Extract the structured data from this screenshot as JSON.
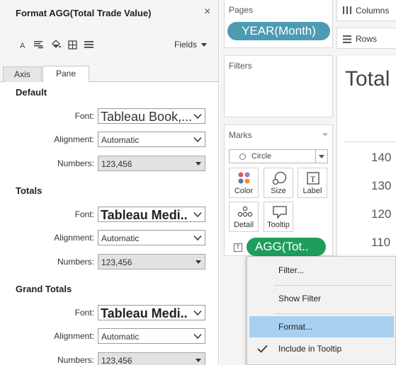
{
  "format_pane": {
    "title": "Format AGG(Total Trade Value)",
    "close_label": "×",
    "toolbar_icons": [
      "font-icon",
      "alignment-icon",
      "shading-icon",
      "borders-icon",
      "lines-icon"
    ],
    "fields_label": "Fields",
    "tabs": [
      {
        "label": "Axis",
        "active": false
      },
      {
        "label": "Pane",
        "active": true
      }
    ],
    "labels": {
      "font": "Font:",
      "alignment": "Alignment:",
      "numbers": "Numbers:"
    },
    "sections": [
      {
        "title": "Default",
        "font": "Tableau Book,...",
        "alignment": "Automatic",
        "numbers": "123,456"
      },
      {
        "title": "Totals",
        "font": "Tableau Medi..",
        "alignment": "Automatic",
        "numbers": "123,456"
      },
      {
        "title": "Grand Totals",
        "font": "Tableau Medi..",
        "alignment": "Automatic",
        "numbers": "123,456"
      }
    ]
  },
  "pages": {
    "title": "Pages",
    "pill": "YEAR(Month)",
    "pill_color": "#4d9bb3"
  },
  "filters": {
    "title": "Filters"
  },
  "marks": {
    "title": "Marks",
    "mark_type": "Circle",
    "buttons": [
      {
        "label": "Color",
        "icon": "color-icon"
      },
      {
        "label": "Size",
        "icon": "size-icon"
      },
      {
        "label": "Label",
        "icon": "label-icon"
      },
      {
        "label": "Detail",
        "icon": "detail-icon"
      },
      {
        "label": "Tooltip",
        "icon": "tooltip-icon"
      }
    ],
    "field_pill": "AGG(Tot..",
    "field_pill_color": "#1d9e5d"
  },
  "shelves": {
    "columns": "Columns",
    "rows": "Rows"
  },
  "view": {
    "title": "Total",
    "axis_ticks": [
      "140",
      "130",
      "120",
      "110"
    ]
  },
  "context_menu": {
    "items": [
      {
        "label": "Filter...",
        "highlighted": false,
        "checked": false
      },
      {
        "label": "Show Filter",
        "highlighted": false,
        "checked": false
      },
      {
        "label": "Format...",
        "highlighted": true,
        "checked": false
      },
      {
        "label": "Include in Tooltip",
        "highlighted": false,
        "checked": true
      }
    ]
  },
  "colors": {
    "highlight": "#a8d0f0",
    "pane_bg": "#f5f5f5"
  }
}
